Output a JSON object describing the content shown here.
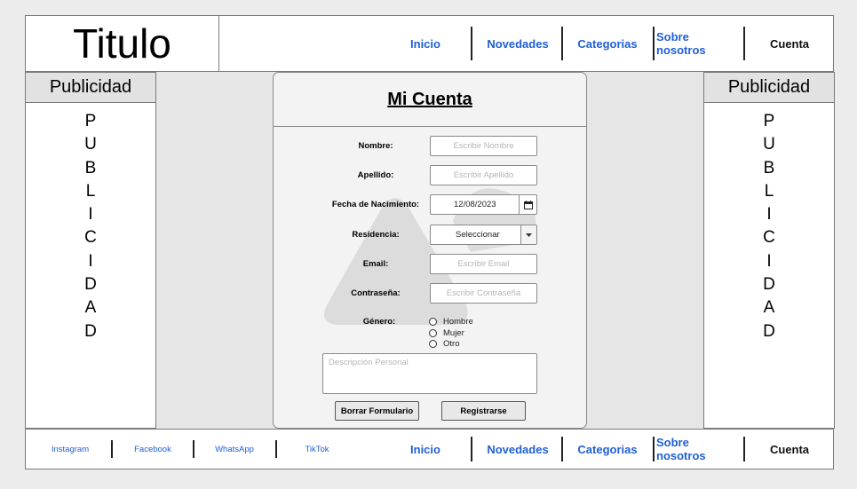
{
  "header": {
    "title": "Titulo",
    "nav": [
      "Inicio",
      "Novedades",
      "Categorias",
      "Sobre nosotros",
      "Cuenta"
    ]
  },
  "ads": {
    "heading": "Publicidad",
    "letters": [
      "P",
      "U",
      "B",
      "L",
      "I",
      "C",
      "I",
      "D",
      "A",
      "D"
    ]
  },
  "form": {
    "title": "Mi Cuenta",
    "fields": {
      "nombre": {
        "label": "Nombre:",
        "placeholder": "Escribir Nombre"
      },
      "apellido": {
        "label": "Apellido:",
        "placeholder": "Escribir Apellido"
      },
      "fecha": {
        "label": "Fecha de Nacimiento:",
        "value": "12/08/2023"
      },
      "residencia": {
        "label": "Residencia:",
        "value": "Seleccionar"
      },
      "email": {
        "label": "Email:",
        "placeholder": "Escribir Email"
      },
      "password": {
        "label": "Contraseña:",
        "placeholder": "Escribir Contraseña"
      },
      "genero": {
        "label": "Género:",
        "options": [
          "Hombre",
          "Mujer",
          "Otro"
        ]
      },
      "descripcion": {
        "placeholder": "Descripción Personal"
      }
    },
    "buttons": {
      "clear": "Borrar Formulario",
      "submit": "Registrarse"
    }
  },
  "footer": {
    "social": [
      "Instagram",
      "Facebook",
      "WhatsApp",
      "TikTok"
    ],
    "nav": [
      "Inicio",
      "Novedades",
      "Categorias",
      "Sobre nosotros",
      "Cuenta"
    ]
  },
  "colors": {
    "link": "#1e5fd6",
    "panel": "#f3f3f3",
    "background": "#e6e6e6"
  }
}
